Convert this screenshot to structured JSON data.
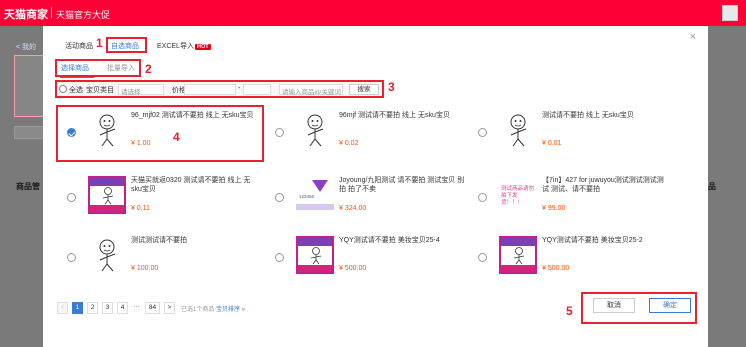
{
  "topbar": {
    "logo": "天猫商家",
    "subtitle": "天猫官方大促"
  },
  "background": {
    "back_label": "< 我的",
    "left_label": "商品管",
    "right_label": "商品"
  },
  "modal": {
    "close_glyph": "×",
    "tabs": [
      {
        "label": "活动商品"
      },
      {
        "label": "自选商品"
      },
      {
        "label": "EXCEL导入",
        "badge": "HOT"
      }
    ],
    "subtabs": [
      {
        "label": "选择商品"
      },
      {
        "label": "批量导入"
      }
    ],
    "filter": {
      "select_all": "全选",
      "category_label": "宝贝类目",
      "category_placeholder": "请选择",
      "price_label": "价格",
      "price_dash": "-",
      "keyword_placeholder": "请输入商品id/关键词",
      "search_button": "搜索"
    },
    "products": [
      {
        "title": "96_mjf02 测试请不要拍 线上 无sku宝贝",
        "price": "¥ 1.00",
        "selected": true
      },
      {
        "title": "96mjf 测试请不要拍 线上 无sku宝贝",
        "price": "¥ 0.02",
        "selected": false
      },
      {
        "title": "测试请不要拍 线上 无sku宝贝",
        "price": "¥ 0.01",
        "selected": false
      },
      {
        "title": "天猫买就返0320 测试请不要拍 线上 无sku宝贝",
        "price": "¥ 0.11",
        "selected": false
      },
      {
        "title": "Joyoung/九阳测试 请不要拍 测试宝贝 别拍 拍了不卖",
        "price": "¥ 324.00",
        "selected": false,
        "img_caption": "123456"
      },
      {
        "title": "【7in】427 for juwuyou测试测试测试测试 测试、请不要拍",
        "price": "¥ 99.00",
        "selected": false,
        "img_caption": "测试商品请勿拍下发货！！！"
      },
      {
        "title": "测试测试请不要拍",
        "price": "¥ 100.00",
        "selected": false
      },
      {
        "title": "YQY测试请不要拍 美妆宝贝25-4",
        "price": "¥ 500.00",
        "selected": false
      },
      {
        "title": "YQY测试请不要拍 美妆宝贝25-2",
        "price": "¥ 500.00",
        "selected": false
      }
    ],
    "pager": {
      "prev": "<",
      "pages": [
        "1",
        "2",
        "3",
        "4"
      ],
      "ellipsis": "···",
      "last": "84",
      "next": ">",
      "selected_text": "已选1个商品",
      "sort_link": "宝贝排序 »"
    },
    "buttons": {
      "cancel": "取消",
      "confirm": "确定"
    }
  },
  "annotations": [
    "1",
    "2",
    "3",
    "4",
    "5"
  ],
  "colors": {
    "accent": "#3a7bd5",
    "price": "#ff5000",
    "annotation": "#e8202f",
    "brand": "#ff0036"
  }
}
